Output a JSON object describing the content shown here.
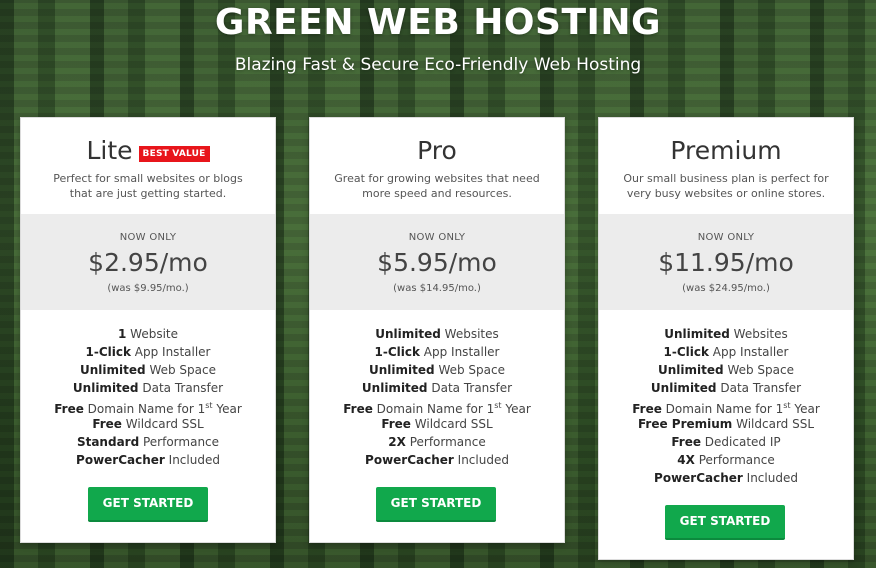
{
  "hero": {
    "title": "GREEN WEB HOSTING",
    "subtitle": "Blazing Fast & Secure Eco-Friendly Web Hosting"
  },
  "colors": {
    "accent_green": "#11a84c",
    "badge_red": "#e8151b",
    "price_band": "#ececec"
  },
  "plans": [
    {
      "name": "Lite",
      "badge": "BEST VALUE",
      "description": "Perfect for small websites or blogs that are just getting started.",
      "now_only": "NOW ONLY",
      "price": "$2.95/mo",
      "was": "(was $9.95/mo.)",
      "features": [
        {
          "bold": "1",
          "text": " Website"
        },
        {
          "bold": "1-Click",
          "text": " App Installer"
        },
        {
          "bold": "Unlimited",
          "text": " Web Space"
        },
        {
          "bold": "Unlimited",
          "text": " Data Transfer"
        },
        {
          "bold": "Free",
          "text": " Domain Name for 1",
          "sup": "st",
          "tail": " Year"
        },
        {
          "bold": "Free",
          "text": " Wildcard SSL"
        },
        {
          "bold": "Standard",
          "text": " Performance"
        },
        {
          "bold": "PowerCacher",
          "text": " Included"
        }
      ],
      "cta": "GET STARTED"
    },
    {
      "name": "Pro",
      "description": "Great for growing websites that need more speed and resources.",
      "now_only": "NOW ONLY",
      "price": "$5.95/mo",
      "was": "(was $14.95/mo.)",
      "features": [
        {
          "bold": "Unlimited",
          "text": " Websites"
        },
        {
          "bold": "1-Click",
          "text": " App Installer"
        },
        {
          "bold": "Unlimited",
          "text": " Web Space"
        },
        {
          "bold": "Unlimited",
          "text": " Data Transfer"
        },
        {
          "bold": "Free",
          "text": " Domain Name for 1",
          "sup": "st",
          "tail": " Year"
        },
        {
          "bold": "Free",
          "text": " Wildcard SSL"
        },
        {
          "bold": "2X",
          "text": " Performance"
        },
        {
          "bold": "PowerCacher",
          "text": " Included"
        }
      ],
      "cta": "GET STARTED"
    },
    {
      "name": "Premium",
      "description": "Our small business plan is perfect for very busy websites or online stores.",
      "now_only": "NOW ONLY",
      "price": "$11.95/mo",
      "was": "(was $24.95/mo.)",
      "features": [
        {
          "bold": "Unlimited",
          "text": " Websites"
        },
        {
          "bold": "1-Click",
          "text": " App Installer"
        },
        {
          "bold": "Unlimited",
          "text": " Web Space"
        },
        {
          "bold": "Unlimited",
          "text": " Data Transfer"
        },
        {
          "bold": "Free",
          "text": " Domain Name for 1",
          "sup": "st",
          "tail": " Year"
        },
        {
          "bold": "Free Premium",
          "text": " Wildcard SSL"
        },
        {
          "bold": "Free",
          "text": " Dedicated IP"
        },
        {
          "bold": "4X",
          "text": " Performance"
        },
        {
          "bold": "PowerCacher",
          "text": " Included"
        }
      ],
      "cta": "GET STARTED"
    }
  ]
}
